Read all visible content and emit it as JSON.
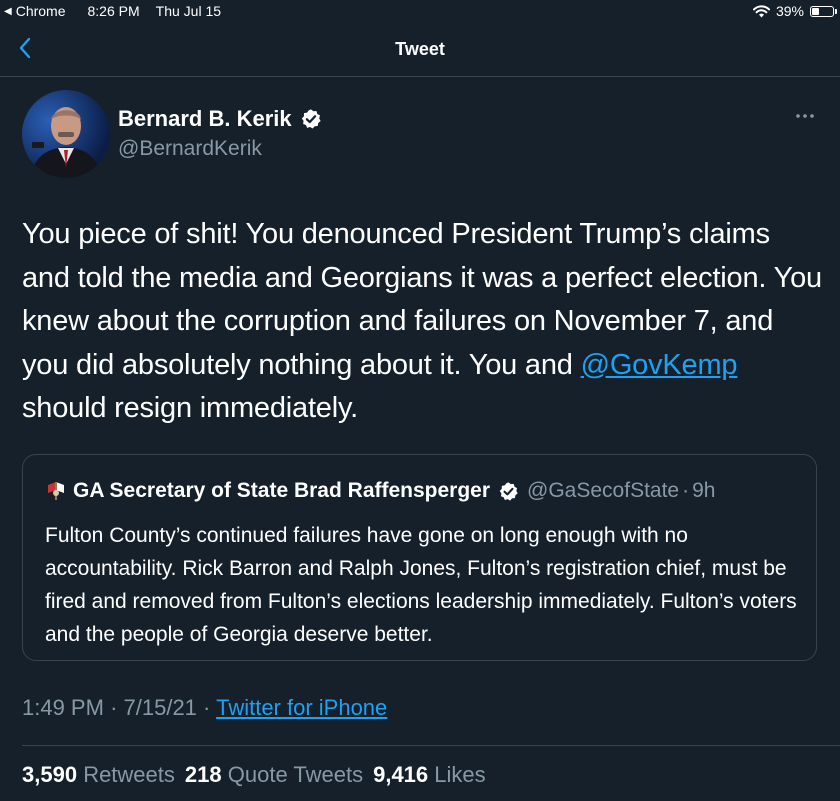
{
  "status_bar": {
    "app": "Chrome",
    "time": "8:26 PM",
    "date": "Thu Jul 15",
    "battery": "39%",
    "battery_level": 0.39
  },
  "nav": {
    "title": "Tweet"
  },
  "author": {
    "name": "Bernard B. Kerik",
    "handle": "@BernardKerik"
  },
  "tweet": {
    "text_before_mention": "You piece of shit! You denounced President Trump’s claims and told the media and Georgians it was a perfect election. You knew about the corruption and failures on November 7, and you did absolutely nothing about it. You and ",
    "mention": "@GovKemp",
    "text_after_mention": " should resign immediately."
  },
  "quote": {
    "name": "GA Secretary of State Brad Raffensperger",
    "handle": "@GaSecofState",
    "separator": "·",
    "age": "9h",
    "text": "Fulton County’s continued failures have gone on long enough with no accountability. Rick Barron and Ralph Jones, Fulton’s registration chief, must be fired and removed from Fulton’s elections leadership immediately. Fulton’s voters and the people of Georgia deserve better."
  },
  "meta": {
    "time": "1:49 PM",
    "separator": "·",
    "date": "7/15/21",
    "separator2": "·",
    "source": "Twitter for iPhone"
  },
  "stats": {
    "retweets_count": "3,590",
    "retweets_label": "Retweets",
    "quotes_count": "218",
    "quotes_label": "Quote Tweets",
    "likes_count": "9,416",
    "likes_label": "Likes"
  },
  "colors": {
    "background": "#15202b",
    "accent": "#1da1f2",
    "muted": "#8899a6",
    "border": "#38444d"
  }
}
